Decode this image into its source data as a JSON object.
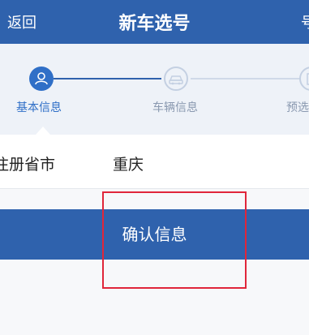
{
  "header": {
    "back_label": "返回",
    "title": "新车选号",
    "right_label": "号"
  },
  "steps": [
    {
      "label": "基本信息",
      "icon": "user-icon",
      "active": true
    },
    {
      "label": "车辆信息",
      "icon": "car-icon",
      "active": false
    },
    {
      "label": "预选",
      "icon": "document-icon",
      "active": false
    }
  ],
  "form": {
    "province_label": "注册省市",
    "province_value": "重庆"
  },
  "confirm_label": "确认信息",
  "colors": {
    "primary": "#2f62ad",
    "active_step": "#2f6fc7",
    "inactive_step": "#8a99b0",
    "highlight": "#e0263a"
  }
}
